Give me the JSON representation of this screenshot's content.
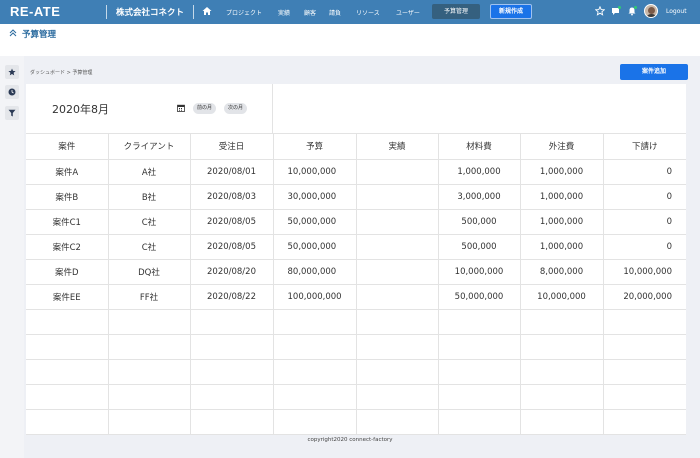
{
  "app": {
    "logo": "RE-ATE",
    "company": "株式会社コネクト"
  },
  "nav": {
    "items": [
      "プロジェクト",
      "実績",
      "顧客",
      "請負",
      "リソース",
      "ユーザー"
    ],
    "active": "予算管理",
    "new_button": "新規作成",
    "logout": "Logout"
  },
  "page": {
    "title": "予算管理"
  },
  "breadcrumb": {
    "home": "ダッシュボード",
    "current": "予算管理"
  },
  "toolbar": {
    "add_label": "案件追加"
  },
  "period": {
    "month": "2020年8月",
    "prev": "前の月",
    "next": "次の月"
  },
  "table": {
    "headers": [
      "案件",
      "クライアント",
      "受注日",
      "予算",
      "実績",
      "材料費",
      "外注費",
      "下請け"
    ],
    "rows": [
      [
        "案件A",
        "A社",
        "2020/08/01",
        "10,000,000",
        "",
        "1,000,000",
        "1,000,000",
        "0"
      ],
      [
        "案件B",
        "B社",
        "2020/08/03",
        "30,000,000",
        "",
        "3,000,000",
        "1,000,000",
        "0"
      ],
      [
        "案件C1",
        "C社",
        "2020/08/05",
        "50,000,000",
        "",
        "500,000",
        "1,000,000",
        "0"
      ],
      [
        "案件C2",
        "C社",
        "2020/08/05",
        "50,000,000",
        "",
        "500,000",
        "1,000,000",
        "0"
      ],
      [
        "案件D",
        "DQ社",
        "2020/08/20",
        "80,000,000",
        "",
        "10,000,000",
        "8,000,000",
        "10,000,000"
      ],
      [
        "案件EE",
        "FF社",
        "2020/08/22",
        "100,000,000",
        "",
        "50,000,000",
        "10,000,000",
        "20,000,000"
      ],
      [
        "",
        "",
        "",
        "",
        "",
        "",
        "",
        ""
      ],
      [
        "",
        "",
        "",
        "",
        "",
        "",
        "",
        ""
      ],
      [
        "",
        "",
        "",
        "",
        "",
        "",
        "",
        ""
      ],
      [
        "",
        "",
        "",
        "",
        "",
        "",
        "",
        ""
      ],
      [
        "",
        "",
        "",
        "",
        "",
        "",
        "",
        ""
      ]
    ]
  },
  "footer": {
    "copyright": "copyright2020 connect-factory"
  },
  "icons": {
    "home": "home-icon",
    "star": "star-icon",
    "chat": "chat-icon",
    "bell": "bell-icon",
    "avatar": "avatar",
    "calendar": "calendar-icon",
    "chevrons": "double-chevron-up-icon",
    "rail": [
      "star-icon",
      "clock-icon",
      "filter-icon"
    ]
  },
  "colors": {
    "header_bg": "#3f7fb5",
    "accent": "#1a73e8",
    "title_color": "#2a6a9e",
    "notification": "#2ecc71"
  }
}
